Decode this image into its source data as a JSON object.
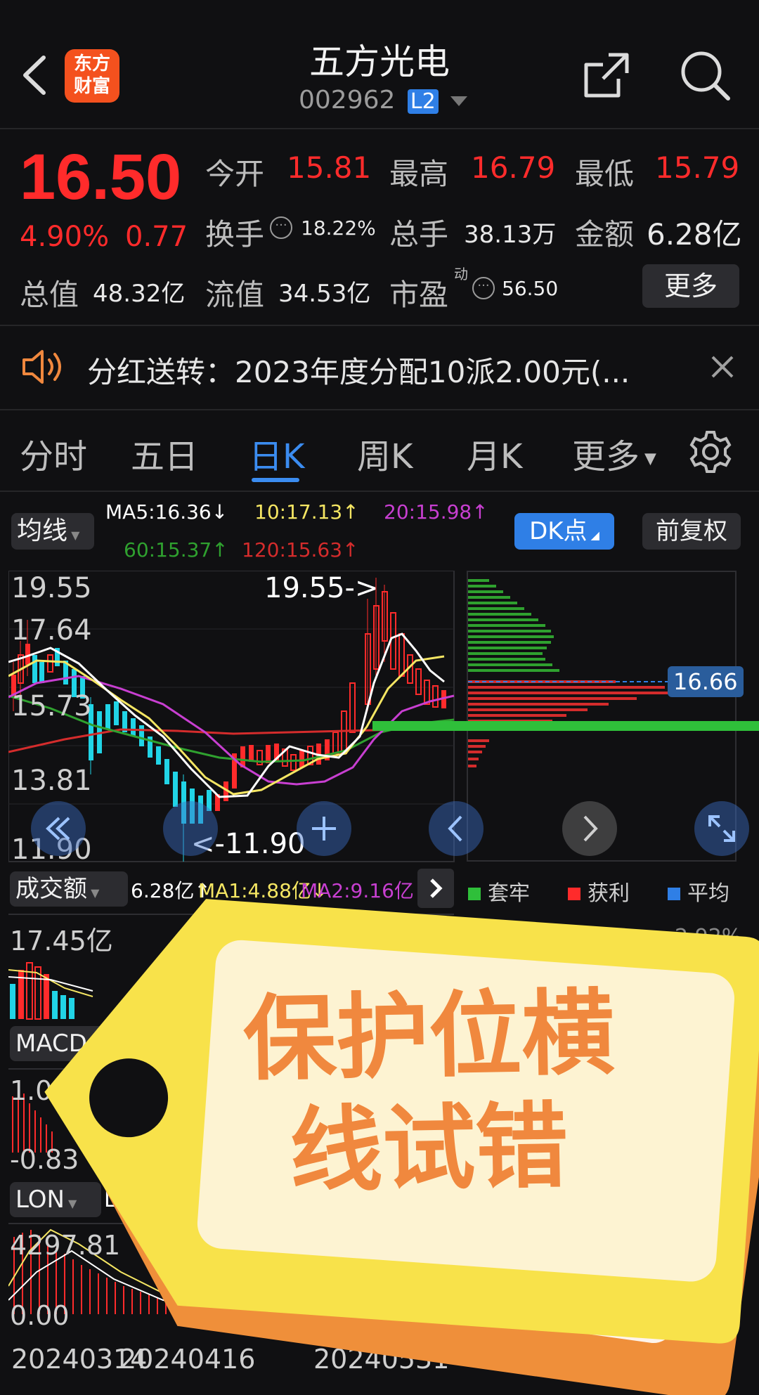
{
  "header": {
    "logo_line1": "东方",
    "logo_line2": "财富",
    "stock_name": "五方光电",
    "stock_code": "002962",
    "level_badge": "L2"
  },
  "quote": {
    "price": "16.50",
    "change_pct": "4.90%",
    "change_abs": "0.77",
    "open_label": "今开",
    "open": "15.81",
    "high_label": "最高",
    "high": "16.79",
    "low_label": "最低",
    "low": "15.79",
    "turnover_label": "换手",
    "turnover": "18.22%",
    "volume_label": "总手",
    "volume": "38.13万",
    "amount_label": "金额",
    "amount": "6.28亿",
    "mktcap_label": "总值",
    "mktcap": "48.32亿",
    "float_label": "流值",
    "float_cap": "34.53亿",
    "pe_label": "市盈",
    "pe_sup": "动",
    "pe": "56.50",
    "more_label": "更多"
  },
  "notice": {
    "text": "分红送转：2023年度分配10派2.00元(..."
  },
  "tabs": [
    "分时",
    "五日",
    "日K",
    "周K",
    "月K",
    "更多"
  ],
  "active_tab": "日K",
  "chart_bar": {
    "indicator_select": "均线",
    "ma5": "MA5:16.36↓",
    "ma10": "10:17.13↑",
    "ma20": "20:15.98↑",
    "ma60": "60:15.37↑",
    "ma120": "120:15.63↑",
    "dk_button": "DK点",
    "adjust_button": "前复权"
  },
  "kline": {
    "y_labels": [
      "19.55",
      "17.64",
      "15.73",
      "13.81",
      "11.90"
    ],
    "high_marker": "19.55->",
    "low_marker": "<-11.90",
    "price_tag": "16.66"
  },
  "volume_bar": {
    "select": "成交额",
    "v": "6.28亿↑",
    "ma1": "MA1:4.88亿↓",
    "ma2": "MA2:9.16亿↑",
    "max_label": "17.45亿"
  },
  "chip_legend": {
    "trapped": "套牢",
    "profit": "获利",
    "average": "平均",
    "pct_partial": "2.92%"
  },
  "macd": {
    "select": "MACD",
    "dif_partial": "DI",
    "top_label": "1.0",
    "bottom_label": "-0.83"
  },
  "lon": {
    "select": "LON",
    "lon_partial": "LO",
    "top_label": "4297.81",
    "bottom_label": "0.00"
  },
  "dates": [
    "20240314",
    "20240416",
    "20240531"
  ],
  "sticker": {
    "line1": "保护位横",
    "line2": "线试错"
  },
  "colors": {
    "up": "#ff2b2b",
    "down": "#21d4e6",
    "accent": "#2f7fe6",
    "ma5": "#ffffff",
    "ma10": "#f5e663",
    "ma20": "#c83fd1",
    "ma60": "#2fa12f",
    "ma120": "#d42c2c",
    "sticker_text": "#f0883e"
  }
}
